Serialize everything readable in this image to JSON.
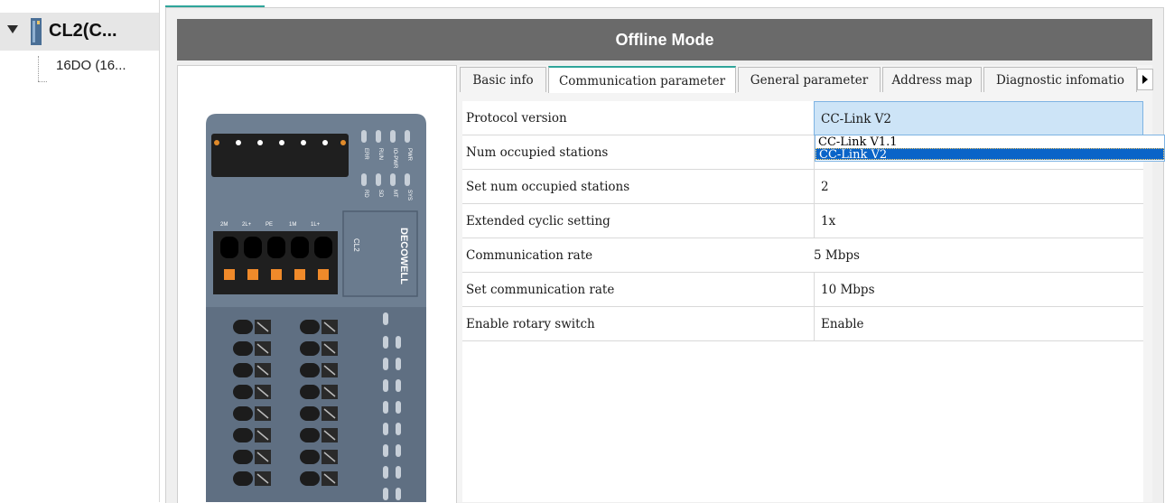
{
  "tree": {
    "root_label": "CL2(C...",
    "child_label": "16DO (16..."
  },
  "title": "Offline Mode",
  "tabs": [
    {
      "label": "Basic info",
      "active": false
    },
    {
      "label": "Communication parameter",
      "active": true
    },
    {
      "label": "General parameter",
      "active": false
    },
    {
      "label": "Address map",
      "active": false
    },
    {
      "label": "Diagnostic infomatio",
      "active": false
    }
  ],
  "params": [
    {
      "name": "Protocol version",
      "value": "CC-Link V2"
    },
    {
      "name": "Num occupied stations",
      "value": ""
    },
    {
      "name": "Set num occupied stations",
      "value": "2"
    },
    {
      "name": "Extended cyclic setting",
      "value": "1x"
    },
    {
      "name": "Communication rate",
      "value": "5 Mbps"
    },
    {
      "name": "Set communication rate",
      "value": "10 Mbps"
    },
    {
      "name": "Enable rotary switch",
      "value": "Enable"
    }
  ],
  "dropdown": {
    "options": [
      "CC-Link V1.1",
      "CC-Link V2"
    ],
    "selected": "CC-Link V2"
  },
  "device": {
    "brand": "DECOWELL",
    "model": "CL2",
    "led_labels_top": [
      "ERR",
      "RUN",
      "IO-PWR",
      "PWR"
    ],
    "led_labels_bottom": [
      "RD",
      "SD",
      "MT",
      "SYS"
    ],
    "terminal_labels": [
      "2M",
      "2L+",
      "PE",
      "1M",
      "1L+"
    ]
  },
  "colors": {
    "accent": "#2fa59a",
    "title_bar": "#6a6a6a",
    "device_body": "#6e7f92",
    "terminal_orange": "#f08a2a",
    "selection_blue": "#0a64c8"
  }
}
